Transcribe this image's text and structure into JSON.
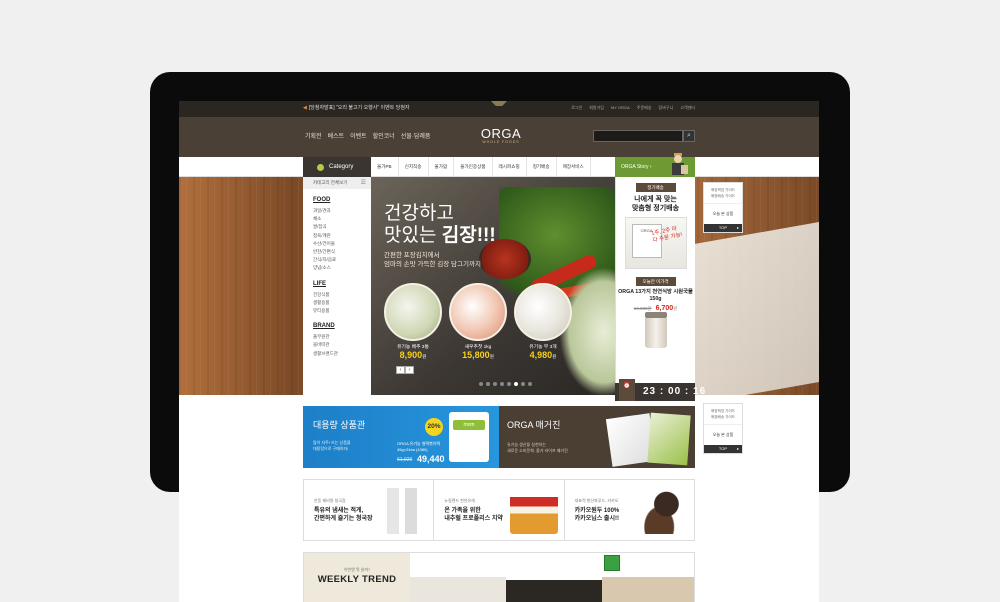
{
  "colors": {
    "accent_green": "#6e9a34",
    "dark_brown": "#4a4036",
    "price_yellow": "#f6d21b",
    "banner_blue": "#2796dd"
  },
  "topbar": {
    "notice": "[당첨자발표] \"오리 불고기 오행사\" 이벤트 당첨자",
    "utils": [
      "로그인",
      "회원가입",
      "MY ORGA",
      "주문배송",
      "장바구니",
      "고객센터"
    ]
  },
  "header": {
    "gnb": [
      "기획전",
      "베스트",
      "이벤트",
      "할인코너",
      "선물·답례품"
    ],
    "logo": "ORGA",
    "logo_tagline": "WHOLE FOODS",
    "search_icon": "search-icon"
  },
  "nav": {
    "category_label": "Category",
    "menu": [
      "올가PB",
      "신지직송",
      "올가맘",
      "올가인증상품",
      "레시피쇼핑",
      "정기배송",
      "매장서비스"
    ],
    "story_label": "ORGA Story ›"
  },
  "sidebar": {
    "all_label": "카테고리 전체보기",
    "groups": [
      {
        "title": "FOOD",
        "items": [
          "과일/견과",
          "채소",
          "쌀/잡곡",
          "정육/계란",
          "수산/건어물",
          "반찬/간편식",
          "간식/차/음료",
          "양념/소스"
        ]
      },
      {
        "title": "LIFE",
        "items": [
          "건강식품",
          "생활용품",
          "뷰티용품"
        ]
      },
      {
        "title": "BRAND",
        "items": [
          "풀무원관",
          "올바따관",
          "생활브랜드관"
        ]
      }
    ]
  },
  "hero": {
    "line1": "건강하고",
    "line2_plain": "맛있는",
    "line2_bold": "김장!!!",
    "sub1": "간편한 포장김치에서",
    "sub2": "엄마의 손맛 가득한 김장 담그기까지",
    "items": [
      {
        "name": "유기농 배추 3통",
        "price": "8,900",
        "unit": "원"
      },
      {
        "name": "새우추젓 1kg",
        "price": "15,800",
        "unit": "원"
      },
      {
        "name": "유기농 무 3개",
        "price": "4,980",
        "unit": "원"
      }
    ],
    "arrows": [
      "‹",
      "›"
    ],
    "slide_count": 8,
    "active_slide": 5
  },
  "today": {
    "label1": "정기배송",
    "title1_a": "나에게 꼭 맞는",
    "title1_b": "맞춤형 정기배송",
    "box_text": "ORGA",
    "scribble": "1주, 2주 마다 주문 가능!",
    "label2": "오늘만 이가격",
    "title2": "ORGA 13가지 천연식방 시원국물 150g",
    "old_price": "10,500원",
    "new_price": "6,700",
    "price_unit": "원",
    "timer": "23 : 00 : 16"
  },
  "quick": {
    "guide1": "매장픽업 가이드",
    "guide2": "매장배송 가이드",
    "today_btn": "오늘 본 상품",
    "top_btn": "TOP"
  },
  "banner_bulk": {
    "title": "대용량 상품관",
    "desc1": "많이 자주! 쓰는 상품을",
    "desc2": "대용량으로 구매하자!",
    "discount": "20%",
    "pack_label": "mom",
    "product1": "ORGA 유기농 쌀떡볶이떡",
    "product2": "45g×24ea (1080)",
    "old_price": "61,920",
    "new_price": "49,440"
  },
  "banner_mag": {
    "title": "ORGA 매거진",
    "desc1": "유기농 생산을 실천하는",
    "desc2": "새로운 소비문화, 올가 라이프 매거진"
  },
  "promos": [
    {
      "sub": "안동 제비원 청국장",
      "title1": "특유의 냄새는 적게,",
      "title2": "간편하게 즐기는 청국장"
    },
    {
      "sub": "뉴질랜드 천연유래",
      "title1": "온 가족을 위한",
      "title2": "내추럴 프로폴리스 치약"
    },
    {
      "sub": "대표적 항산화푸드, 카카오",
      "title1": "카카오원두 100%",
      "title2": "카카오닙스 출시!!"
    }
  ],
  "trend": {
    "sub": "이번엔 뭐 살까?",
    "title": "WEEKLY TREND"
  }
}
